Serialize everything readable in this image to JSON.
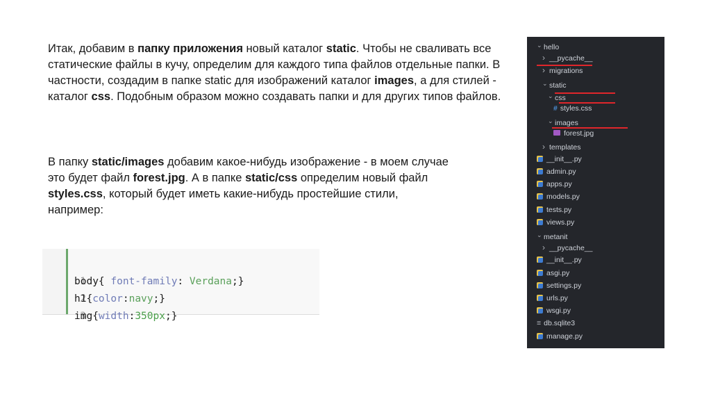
{
  "paragraph1": {
    "s1": "Итак, добавим в ",
    "b1": "папку приложения",
    "s2": " новый каталог ",
    "b2": "static",
    "s3": ". Чтобы не сваливать все статические файлы в кучу, определим для каждого типа файлов отдельные папки. В частности, создадим в папке static для изображений каталог ",
    "b3": "images",
    "s4": ", а для стилей - каталог ",
    "b4": "css",
    "s5": ". Подобным образом можно создавать папки и для других типов файлов."
  },
  "paragraph2": {
    "s1": "В папку ",
    "b1": "static/images",
    "s2": " добавим какое-нибудь изображение - в моем случае это будет файл ",
    "b2": "forest.jpg",
    "s3": ". А в папке ",
    "b3": "static/css",
    "s4": " определим новый файл ",
    "b4": "styles.css",
    "s5": ", который будет иметь какие-нибудь простейшие стили, например:"
  },
  "code": {
    "lines": [
      {
        "num": "1",
        "sel": "body",
        "open": "{ ",
        "prop": "font-family",
        "colon": ": ",
        "val": "Verdana",
        "close": ";}"
      },
      {
        "num": "2",
        "sel": "h1",
        "open": "{",
        "prop": "color",
        "colon": ":",
        "val": "navy",
        "close": ";}"
      },
      {
        "num": "3",
        "sel": "img",
        "open": "{",
        "prop": "width",
        "colon": ":",
        "val": "350px",
        "close": ";}"
      }
    ]
  },
  "tree": {
    "items": [
      {
        "label": "hello",
        "icon": "chevron-down"
      },
      {
        "label": "__pycache__",
        "icon": "chevron-right"
      },
      {
        "label": "migrations",
        "icon": "chevron-right"
      },
      {
        "label": "static",
        "icon": "chevron-down"
      },
      {
        "label": "css",
        "icon": "chevron-down"
      },
      {
        "label": "styles.css",
        "icon": "css-hash"
      },
      {
        "label": "images",
        "icon": "chevron-down"
      },
      {
        "label": "forest.jpg",
        "icon": "image"
      },
      {
        "label": "templates",
        "icon": "chevron-right"
      },
      {
        "label": "__init__.py",
        "icon": "python"
      },
      {
        "label": "admin.py",
        "icon": "python"
      },
      {
        "label": "apps.py",
        "icon": "python"
      },
      {
        "label": "models.py",
        "icon": "python"
      },
      {
        "label": "tests.py",
        "icon": "python"
      },
      {
        "label": "views.py",
        "icon": "python"
      },
      {
        "label": "metanit",
        "icon": "chevron-down"
      },
      {
        "label": "__pycache__",
        "icon": "chevron-right"
      },
      {
        "label": "__init__.py",
        "icon": "python"
      },
      {
        "label": "asgi.py",
        "icon": "python"
      },
      {
        "label": "settings.py",
        "icon": "python"
      },
      {
        "label": "urls.py",
        "icon": "python"
      },
      {
        "label": "wsgi.py",
        "icon": "python"
      },
      {
        "label": "db.sqlite3",
        "icon": "database"
      },
      {
        "label": "manage.py",
        "icon": "python"
      }
    ],
    "highlight_color": "#e0262b"
  }
}
